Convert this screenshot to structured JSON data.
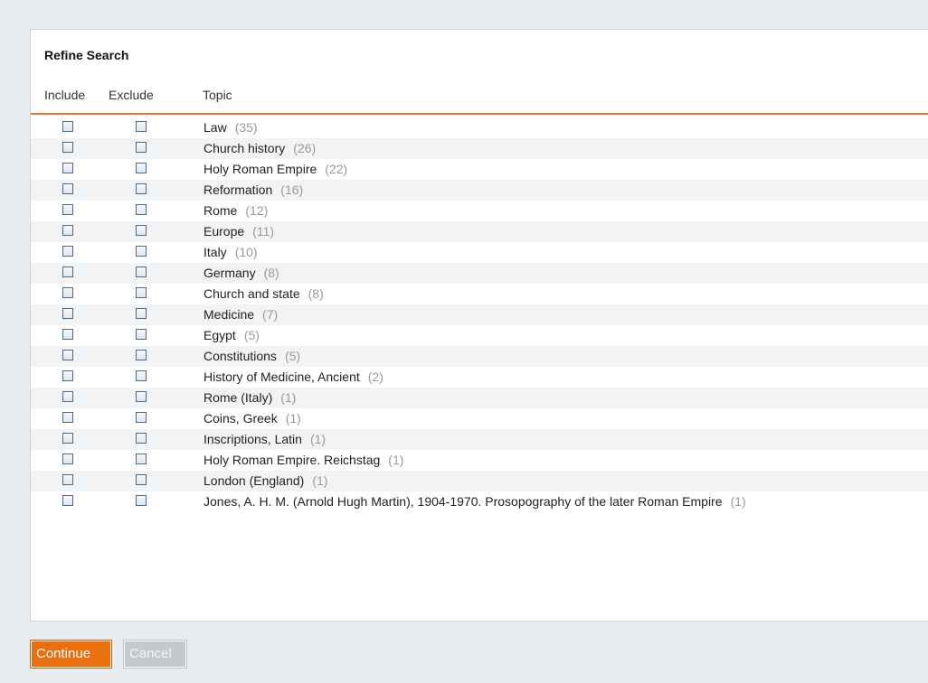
{
  "panel": {
    "title": "Refine Search",
    "columns": {
      "include": "Include",
      "exclude": "Exclude",
      "topic": "Topic"
    }
  },
  "topics": [
    {
      "label": "Law",
      "count": "(35)"
    },
    {
      "label": "Church history",
      "count": "(26)"
    },
    {
      "label": "Holy Roman Empire",
      "count": "(22)"
    },
    {
      "label": "Reformation",
      "count": "(16)"
    },
    {
      "label": "Rome",
      "count": "(12)"
    },
    {
      "label": "Europe",
      "count": "(11)"
    },
    {
      "label": "Italy",
      "count": "(10)"
    },
    {
      "label": "Germany",
      "count": "(8)"
    },
    {
      "label": "Church and state",
      "count": "(8)"
    },
    {
      "label": "Medicine",
      "count": "(7)"
    },
    {
      "label": "Egypt",
      "count": "(5)"
    },
    {
      "label": "Constitutions",
      "count": "(5)"
    },
    {
      "label": "History of Medicine, Ancient",
      "count": "(2)"
    },
    {
      "label": "Rome (Italy)",
      "count": "(1)"
    },
    {
      "label": "Coins, Greek",
      "count": "(1)"
    },
    {
      "label": "Inscriptions, Latin",
      "count": "(1)"
    },
    {
      "label": "Holy Roman Empire. Reichstag",
      "count": "(1)"
    },
    {
      "label": "London (England)",
      "count": "(1)"
    },
    {
      "label": "Jones, A. H. M. (Arnold Hugh Martin), 1904-1970. Prosopography of the later Roman Empire",
      "count": "(1)"
    }
  ],
  "buttons": {
    "continue": "Continue",
    "cancel": "Cancel"
  },
  "colors": {
    "accent": "#e8700f",
    "divider": "#e8732a"
  }
}
